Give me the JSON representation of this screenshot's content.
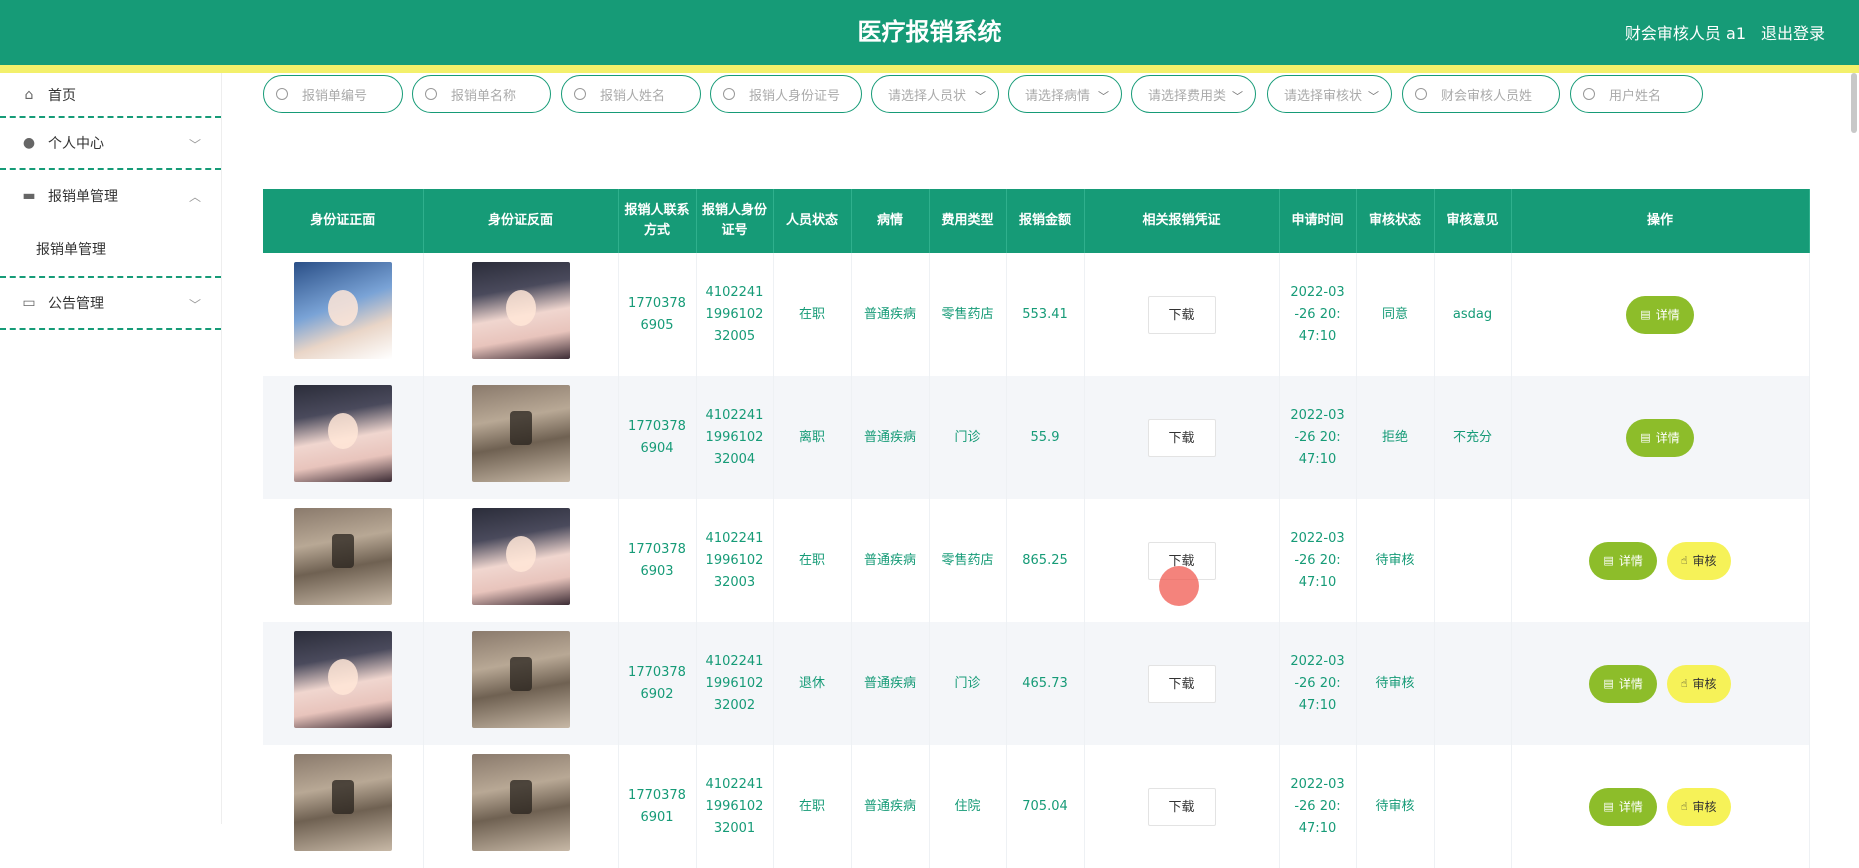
{
  "app": {
    "title": "医疗报销系统",
    "user": "财会审核人员 a1",
    "logout": "退出登录"
  },
  "sidebar": {
    "items": [
      {
        "label": "首页",
        "icon": "home-icon"
      },
      {
        "label": "个人中心",
        "icon": "user-icon"
      },
      {
        "label": "报销单管理",
        "icon": "chat-icon",
        "sub": "报销单管理"
      },
      {
        "label": "公告管理",
        "icon": "board-icon"
      }
    ]
  },
  "search": {
    "fields": [
      {
        "placeholder": "报销单编号"
      },
      {
        "placeholder": "报销单名称"
      },
      {
        "placeholder": "报销人姓名"
      },
      {
        "placeholder": "报销人身份证号"
      },
      {
        "placeholder": "请选择人员状"
      },
      {
        "placeholder": "请选择病情"
      },
      {
        "placeholder": "请选择费用类"
      },
      {
        "placeholder": "请选择审核状"
      },
      {
        "placeholder": "财会审核人员姓"
      },
      {
        "placeholder": "用户姓名"
      }
    ]
  },
  "table": {
    "columns": [
      "身份证正面",
      "身份证反面",
      "报销人联系方式",
      "报销人身份证号",
      "人员状态",
      "病情",
      "费用类型",
      "报销金额",
      "相关报销凭证",
      "申请时间",
      "审核状态",
      "审核意见",
      "操作"
    ],
    "download_label": "下载",
    "detail_label": "详情",
    "audit_label": "审核",
    "rows": [
      {
        "front": "ph-a",
        "back": "ph-b",
        "phone": "17703786905",
        "id": "410224119961023 2005",
        "staff": "在职",
        "illness": "普通疾病",
        "fee": "零售药店",
        "amount": "553.41",
        "time": "2022-03-26 20:47:10",
        "status": "同意",
        "opinion": "asdag",
        "audit": false
      },
      {
        "front": "ph-b",
        "back": "ph-c",
        "phone": "17703786904",
        "id": "410224119961023 2004",
        "staff": "离职",
        "illness": "普通疾病",
        "fee": "门诊",
        "amount": "55.9",
        "time": "2022-03-26 20:47:10",
        "status": "拒绝",
        "opinion": "不充分",
        "audit": false
      },
      {
        "front": "ph-c",
        "back": "ph-b",
        "phone": "17703786903",
        "id": "410224119961023 2003",
        "staff": "在职",
        "illness": "普通疾病",
        "fee": "零售药店",
        "amount": "865.25",
        "time": "2022-03-26 20:47:10",
        "status": "待审核",
        "opinion": "",
        "audit": true
      },
      {
        "front": "ph-b",
        "back": "ph-c",
        "phone": "17703786902",
        "id": "410224119961023 2002",
        "staff": "退休",
        "illness": "普通疾病",
        "fee": "门诊",
        "amount": "465.73",
        "time": "2022-03-26 20:47:10",
        "status": "待审核",
        "opinion": "",
        "audit": true
      },
      {
        "front": "ph-c",
        "back": "ph-c",
        "phone": "17703786901",
        "id": "410224119961023 2001",
        "staff": "在职",
        "illness": "普通疾病",
        "fee": "住院",
        "amount": "705.04",
        "time": "2022-03-26 20:47:10",
        "status": "待审核",
        "opinion": "",
        "audit": true
      }
    ]
  },
  "overlay_text": ""
}
